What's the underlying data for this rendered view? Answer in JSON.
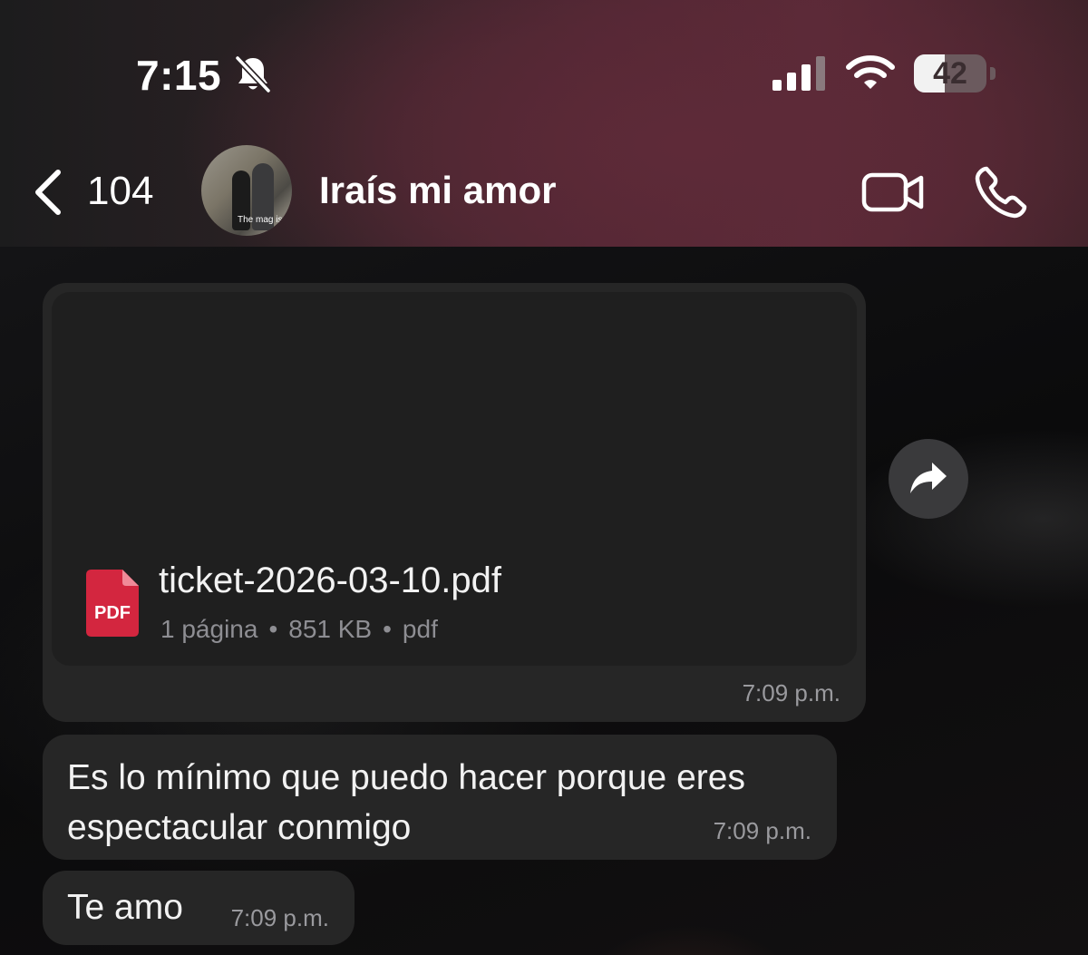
{
  "status_bar": {
    "time": "7:15",
    "silent_icon": "bell-slash-icon",
    "signal_icon": "cellular-signal-icon",
    "wifi_icon": "wifi-icon",
    "battery_level": "42",
    "battery_percent": 42
  },
  "header": {
    "back_icon": "chevron-left-icon",
    "back_count": "104",
    "contact_name": "Iraís mi amor",
    "avatar_caption": "The mag is in",
    "video_call_icon": "video-camera-icon",
    "voice_call_icon": "phone-icon",
    "accent_color": "#5a2937"
  },
  "messages": {
    "pdf": {
      "file_name": "ticket-2026-03-10.pdf",
      "badge": "PDF",
      "pages": "1 página",
      "size": "851 KB",
      "type": "pdf",
      "separator": "•",
      "time": "7:09 p.m.",
      "file_icon": "pdf-file-icon",
      "forward_icon": "forward-arrow-icon"
    },
    "text1": {
      "text": "Es lo mínimo que puedo hacer porque eres espectacular conmigo",
      "time": "7:09 p.m."
    },
    "text2": {
      "text": "Te amo",
      "time": "7:09 p.m."
    }
  },
  "colors": {
    "bubble": "#262626",
    "pdf_red": "#d3263f",
    "timestamp": "#9a9a9e"
  }
}
